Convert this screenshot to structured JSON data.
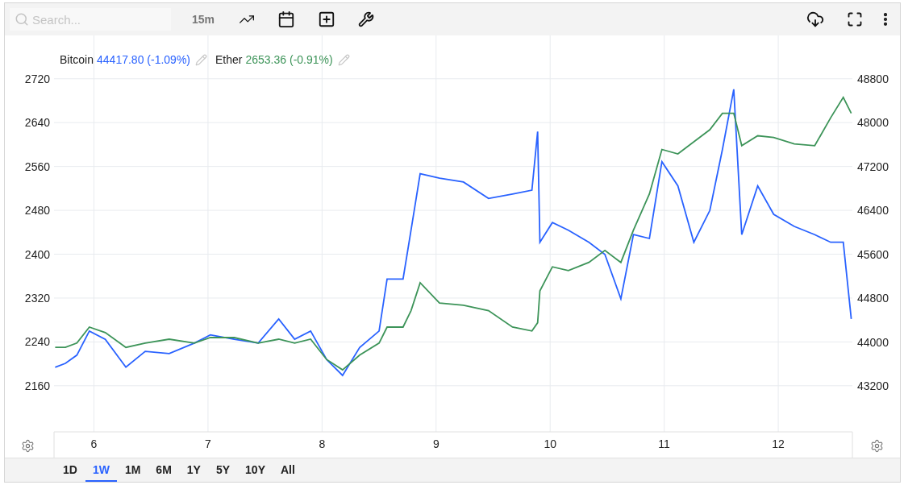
{
  "toolbar": {
    "search": {
      "placeholder": "Search..."
    },
    "interval": "15m"
  },
  "legend": [
    {
      "value": "44417.80 (-1.09%)",
      "color": "#2962ff"
    },
    {
      "value": "2653.36 (-0.91%)",
      "color": "#3d9459"
    }
  ],
  "chart_data": {
    "type": "line",
    "grid": true,
    "xlim": [
      5.65,
      12.65
    ],
    "xticks": [
      6,
      7,
      8,
      9,
      10,
      11,
      12
    ],
    "ylim": [
      2076,
      2799
    ],
    "yticks": [
      2160,
      2240,
      2320,
      2400,
      2480,
      2560,
      2640,
      2720
    ],
    "y2lim": [
      42361,
      49594
    ],
    "y2ticks": [
      43200,
      44000,
      44800,
      45600,
      46400,
      47200,
      48000,
      48800
    ],
    "x": [
      5.66,
      5.75,
      5.85,
      5.96,
      6.1,
      6.28,
      6.45,
      6.66,
      6.88,
      7.02,
      7.23,
      7.44,
      7.62,
      7.76,
      7.9,
      8.04,
      8.18,
      8.33,
      8.5,
      8.57,
      8.71,
      8.78,
      8.86,
      9.03,
      9.24,
      9.46,
      9.67,
      9.84,
      9.89,
      9.91,
      10.02,
      10.16,
      10.34,
      10.48,
      10.62,
      10.73,
      10.87,
      10.98,
      11.12,
      11.26,
      11.4,
      11.51,
      11.61,
      11.68,
      11.82,
      11.96,
      12.14,
      12.32,
      12.46,
      12.57,
      12.64
    ],
    "series": [
      {
        "name": "Bitcoin",
        "color": "#2962ff",
        "axis": "y2",
        "values": [
          43540,
          43610,
          43760,
          44200,
          44050,
          43540,
          43830,
          43790,
          43980,
          44130,
          44050,
          43980,
          44420,
          44050,
          44200,
          43680,
          43390,
          43900,
          44200,
          45150,
          45150,
          46040,
          47070,
          46990,
          46920,
          46620,
          46700,
          46770,
          47840,
          45820,
          46180,
          46040,
          45820,
          45600,
          44790,
          45960,
          45890,
          47290,
          46850,
          45820,
          46400,
          47510,
          48610,
          45960,
          46850,
          46330,
          46110,
          45960,
          45820,
          45820,
          44420
        ]
      },
      {
        "name": "Ether",
        "color": "#3d9459",
        "values": [
          2230,
          2230,
          2238,
          2267,
          2257,
          2230,
          2238,
          2245,
          2238,
          2248,
          2248,
          2238,
          2245,
          2238,
          2245,
          2208,
          2189,
          2216,
          2238,
          2267,
          2267,
          2297,
          2348,
          2311,
          2307,
          2297,
          2267,
          2260,
          2275,
          2333,
          2377,
          2370,
          2385,
          2407,
          2385,
          2444,
          2510,
          2591,
          2583,
          2605,
          2627,
          2657,
          2657,
          2598,
          2616,
          2613,
          2601,
          2598,
          2649,
          2686,
          2657
        ]
      }
    ]
  },
  "ranges": [
    {
      "label": "1D",
      "selected": false
    },
    {
      "label": "1W",
      "selected": true
    },
    {
      "label": "1M",
      "selected": false
    },
    {
      "label": "6M",
      "selected": false
    },
    {
      "label": "1Y",
      "selected": false
    },
    {
      "label": "5Y",
      "selected": false
    },
    {
      "label": "10Y",
      "selected": false
    },
    {
      "label": "All",
      "selected": false
    }
  ]
}
